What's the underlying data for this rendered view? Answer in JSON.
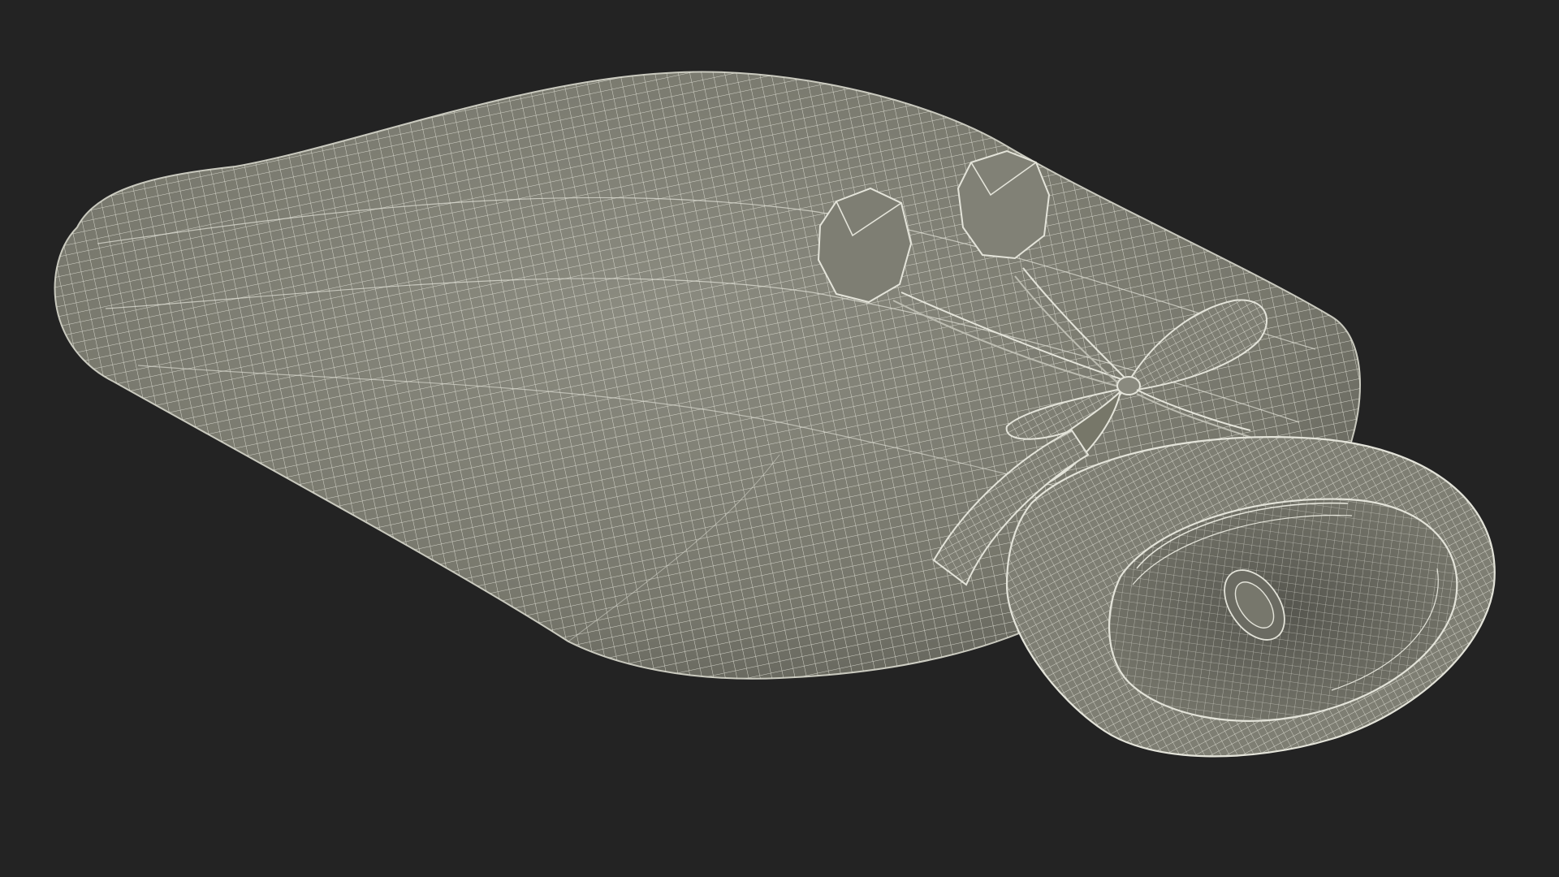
{
  "scene": {
    "subject": "wireframe-3d-model",
    "colors": {
      "background": "#232323",
      "surface": "#7b7b70",
      "surface_light": "#8a8a7f",
      "surface_dark": "#5f5f57",
      "wire": "#e4e4da",
      "inner": "#6c6c63"
    }
  }
}
